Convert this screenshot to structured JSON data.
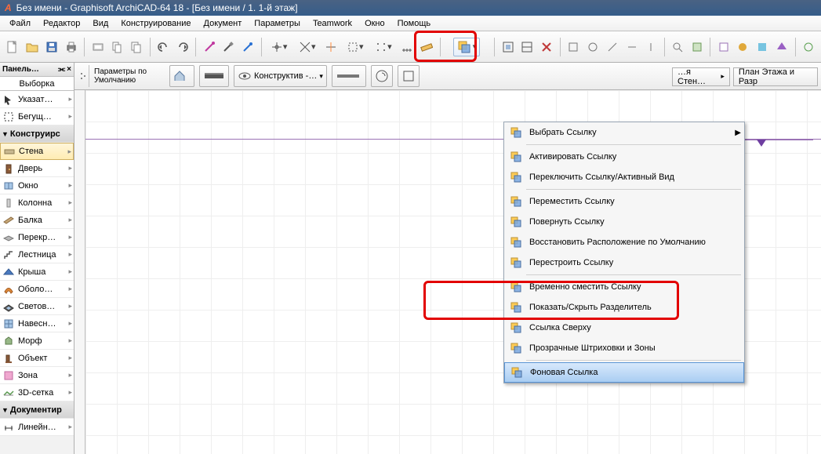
{
  "titlebar": "Без имени - Graphisoft ArchiCAD-64 18 - [Без имени / 1. 1-й этаж]",
  "menubar": [
    "Файл",
    "Редактор",
    "Вид",
    "Конструирование",
    "Документ",
    "Параметры",
    "Teamwork",
    "Окно",
    "Помощь"
  ],
  "left_panel": {
    "title": "Панель…",
    "subtitle": "Выборка",
    "tools": [
      {
        "label": "Указат…",
        "kind": "arrow",
        "level": 1
      },
      {
        "label": "Бегущ…",
        "kind": "marquee",
        "level": 1
      },
      {
        "label": "Конструирс",
        "kind": "header",
        "level": 0
      },
      {
        "label": "Стена",
        "kind": "wall",
        "level": 1,
        "selected": true
      },
      {
        "label": "Дверь",
        "kind": "door",
        "level": 1
      },
      {
        "label": "Окно",
        "kind": "window",
        "level": 1
      },
      {
        "label": "Колонна",
        "kind": "column",
        "level": 1
      },
      {
        "label": "Балка",
        "kind": "beam",
        "level": 1
      },
      {
        "label": "Перекр…",
        "kind": "slab",
        "level": 1
      },
      {
        "label": "Лестница",
        "kind": "stair",
        "level": 1
      },
      {
        "label": "Крыша",
        "kind": "roof",
        "level": 1
      },
      {
        "label": "Оболо…",
        "kind": "shell",
        "level": 1
      },
      {
        "label": "Светов…",
        "kind": "skylight",
        "level": 1
      },
      {
        "label": "Навесн…",
        "kind": "curtain",
        "level": 1
      },
      {
        "label": "Морф",
        "kind": "morph",
        "level": 1
      },
      {
        "label": "Объект",
        "kind": "object",
        "level": 1
      },
      {
        "label": "Зона",
        "kind": "zone",
        "level": 1
      },
      {
        "label": "3D-сетка",
        "kind": "mesh",
        "level": 1
      },
      {
        "label": "Документир",
        "kind": "header",
        "level": 0
      },
      {
        "label": "Линейн…",
        "kind": "dim",
        "level": 1
      }
    ]
  },
  "infobar": {
    "label": "Параметры по Умолчанию",
    "construct": "Конструктив -…",
    "right1": "…я Стен…",
    "right2": "План Этажа и Разр"
  },
  "dropdown": {
    "items": [
      {
        "label": "Выбрать Ссылку",
        "arrow": true
      },
      {
        "sep": true
      },
      {
        "label": "Активировать Ссылку"
      },
      {
        "label": "Переключить Ссылку/Активный Вид"
      },
      {
        "sep": true
      },
      {
        "label": "Переместить Ссылку"
      },
      {
        "label": "Повернуть Ссылку"
      },
      {
        "label": "Восстановить Расположение по Умолчанию"
      },
      {
        "label": "Перестроить Ссылку"
      },
      {
        "sep": true
      },
      {
        "label": "Временно сместить Ссылку"
      },
      {
        "label": "Показать/Скрыть Разделитель"
      },
      {
        "label": "Ссылка Сверху"
      },
      {
        "label": "Прозрачные Штриховки и Зоны"
      },
      {
        "sep": true
      },
      {
        "label": "Фоновая Ссылка",
        "selected": true
      }
    ]
  }
}
